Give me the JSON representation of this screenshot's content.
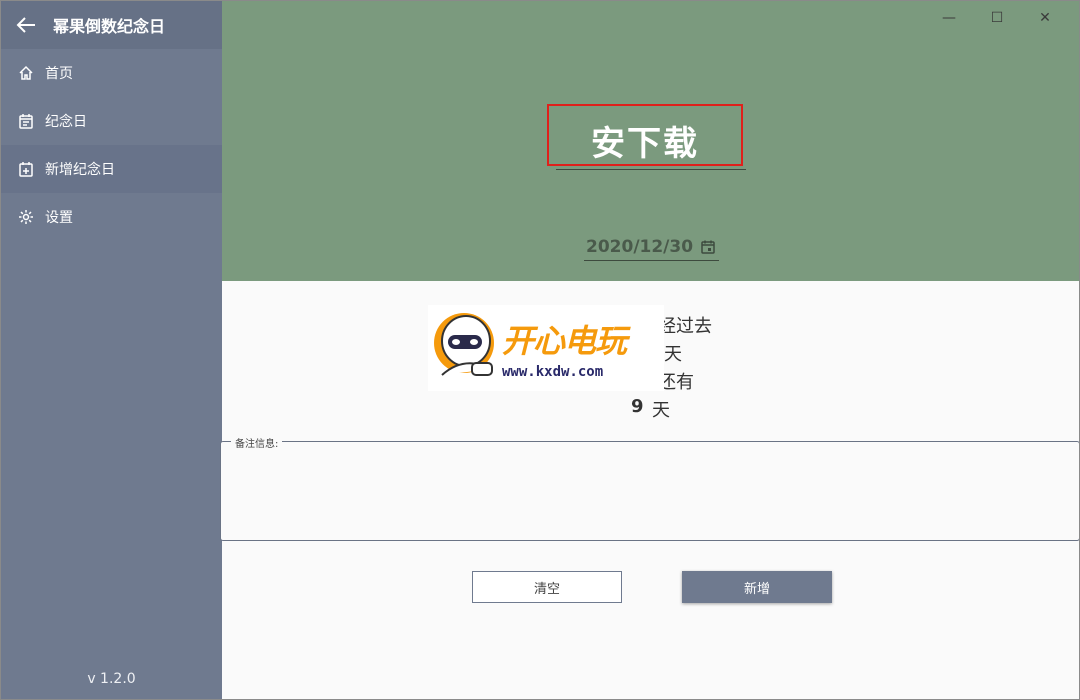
{
  "app": {
    "title": "幂果倒数纪念日",
    "version": "v 1.2.0"
  },
  "sidebar": {
    "items": [
      {
        "label": "首页",
        "icon": "home-icon"
      },
      {
        "label": "纪念日",
        "icon": "event-icon"
      },
      {
        "label": "新增纪念日",
        "icon": "calendar-add-icon"
      },
      {
        "label": "设置",
        "icon": "gear-icon"
      }
    ],
    "active_index": 2
  },
  "window_controls": {
    "minimize": "—",
    "maximize": "☐",
    "close": "✕"
  },
  "form": {
    "title_value": "安下载",
    "date_value": "2020/12/30",
    "notes_legend": "备注信息:",
    "notes_value": ""
  },
  "result": {
    "line1": "经过去",
    "line2": "天",
    "line3": "还有",
    "days_remaining": "9",
    "line4_unit": "天"
  },
  "watermark": {
    "brand": "开心电玩",
    "url": "www.kxdw.com"
  },
  "buttons": {
    "clear_label": "清空",
    "add_label": "新增"
  },
  "colors": {
    "sidebar": "#6f7a8f",
    "hero": "#7b9a7e",
    "highlight": "#e0201b",
    "brand": "#f59a0c"
  }
}
